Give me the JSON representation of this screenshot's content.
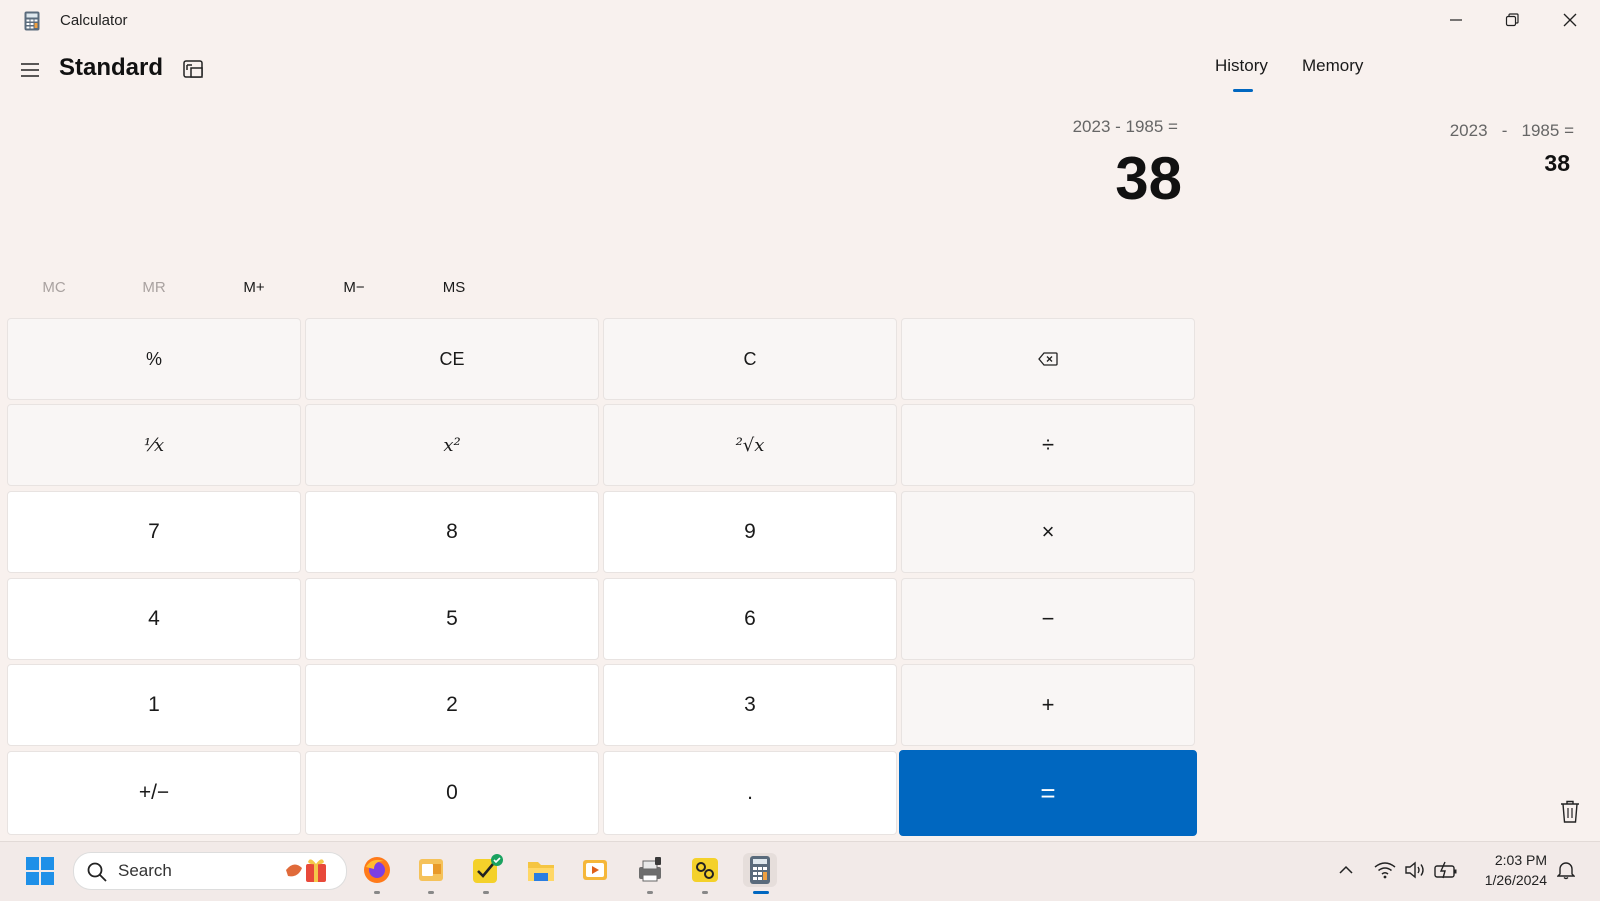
{
  "window": {
    "title": "Calculator"
  },
  "header": {
    "mode": "Standard"
  },
  "display": {
    "expression": "2023 - 1985 =",
    "result": "38"
  },
  "memory_row": [
    {
      "label": "MC",
      "enabled": false
    },
    {
      "label": "MR",
      "enabled": false
    },
    {
      "label": "M+",
      "enabled": true
    },
    {
      "label": "M−",
      "enabled": true
    },
    {
      "label": "MS",
      "enabled": true
    }
  ],
  "keypad": [
    [
      "%",
      "CE",
      "C",
      "⌫"
    ],
    [
      "⅟x",
      "x²",
      "²√x",
      "÷"
    ],
    [
      "7",
      "8",
      "9",
      "×"
    ],
    [
      "4",
      "5",
      "6",
      "−"
    ],
    [
      "1",
      "2",
      "3",
      "+"
    ],
    [
      "+/−",
      "0",
      ".",
      "="
    ]
  ],
  "history_pane": {
    "tabs": [
      "History",
      "Memory"
    ],
    "active_tab": "History",
    "entries": [
      {
        "expression": "2023   -   1985 =",
        "result": "38"
      }
    ]
  },
  "taskbar": {
    "search_placeholder": "Search",
    "apps": [
      "firefox-icon",
      "outlook-icon",
      "todo-icon",
      "file-explorer-icon",
      "media-player-icon",
      "printer-icon",
      "settings-app-icon",
      "calculator-icon"
    ],
    "clock_time": "2:03 PM",
    "clock_date": "1/26/2024"
  },
  "colors": {
    "accent": "#0067c0",
    "background": "#f8f1ee"
  }
}
